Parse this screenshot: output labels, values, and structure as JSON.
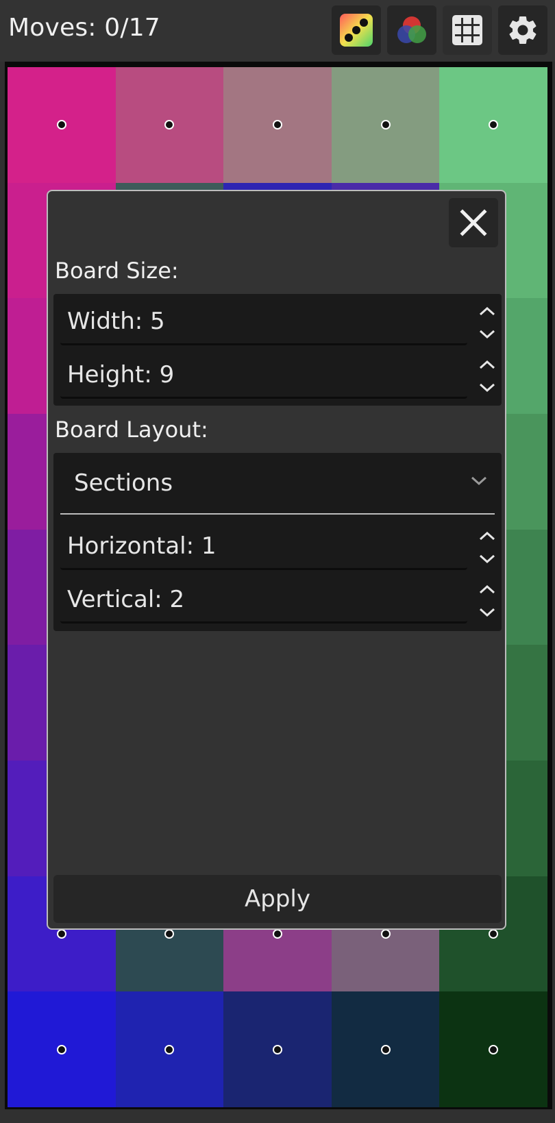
{
  "header": {
    "moves_text": "Moves: 0/17",
    "buttons": [
      {
        "name": "dice-icon"
      },
      {
        "name": "color-circles-icon"
      },
      {
        "name": "grid-icon"
      },
      {
        "name": "gear-icon"
      }
    ]
  },
  "board": {
    "columns": 5,
    "rows": 9,
    "tile_colors": [
      [
        "#d4218a",
        "#b84c80",
        "#a37682",
        "#849c80",
        "#6cc784"
      ],
      [
        "#ca1f8e",
        "#3d5b5a",
        "#2e25b3",
        "#4a2ba8",
        "#60b575"
      ],
      [
        "#bf1e93",
        "#b41c9a",
        "#a31ca0",
        "#7e47a3",
        "#54a66a"
      ],
      [
        "#9a1d9c",
        "#811d9f",
        "#711da1",
        "#621da3",
        "#4a955c"
      ],
      [
        "#7f1da3",
        "#6f1da5",
        "#5f1da7",
        "#4f1da9",
        "#3e8450"
      ],
      [
        "#6a1dab",
        "#5b1dad",
        "#4c1daf",
        "#3d1db1",
        "#357443"
      ],
      [
        "#531dbb",
        "#461dbd",
        "#391dbf",
        "#2c1dc1",
        "#2b6538"
      ],
      [
        "#3d1dc8",
        "#2d4a52",
        "#8c3e88",
        "#7a617a",
        "#1f512b"
      ],
      [
        "#2019d6",
        "#1f23b0",
        "#1a2571",
        "#122b42",
        "#0c3312"
      ]
    ]
  },
  "dialog": {
    "board_size_label": "Board Size:",
    "width_label": "Width: 5",
    "height_label": "Height: 9",
    "board_layout_label": "Board Layout:",
    "layout_select_value": "Sections",
    "horizontal_label": "Horizontal: 1",
    "vertical_label": "Vertical: 2",
    "apply_label": "Apply"
  }
}
